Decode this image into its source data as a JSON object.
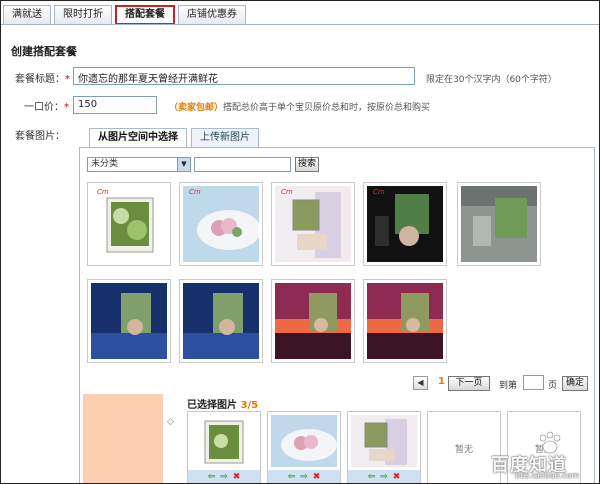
{
  "top_tabs": [
    {
      "label": "满就送",
      "active": false
    },
    {
      "label": "限时打折",
      "active": false
    },
    {
      "label": "搭配套餐",
      "active": true
    },
    {
      "label": "店铺优惠券",
      "active": false
    }
  ],
  "section_title": "创建搭配套餐",
  "form": {
    "title_label": "套餐标题：",
    "title_value": "你遗忘的那年夏天曾经开满鲜花",
    "title_hint": "限定在30个汉字内（60个字符）",
    "price_label": "一口价：",
    "price_value": "150",
    "price_hint_tag": "（卖家包邮）",
    "price_hint": "搭配总价高于单个宝贝原价总和时，按原价总和购买",
    "image_label": "套餐图片：",
    "required_mark": "*"
  },
  "image_tabs": [
    {
      "label": "从图片空间中选择",
      "active": true
    },
    {
      "label": "上传新图片",
      "active": false
    }
  ],
  "category_select": {
    "value": "未分类"
  },
  "search_button": "搜索",
  "thumb_logo_text": "Cm",
  "thumbnails": [
    {
      "theme": "green-frame"
    },
    {
      "theme": "plate"
    },
    {
      "theme": "curtain"
    },
    {
      "theme": "dark-portrait"
    },
    {
      "theme": "stone-window"
    },
    {
      "theme": "blue-night"
    },
    {
      "theme": "blue-night"
    },
    {
      "theme": "sunset"
    },
    {
      "theme": "sunset"
    }
  ],
  "pagination": {
    "current": "1",
    "next_label": "下一页",
    "goto_label": "到第",
    "page_unit": "页",
    "confirm_label": "确定"
  },
  "selected": {
    "title": "已选择图片",
    "count": "3/5",
    "empty_label": "暂无"
  },
  "watermark": {
    "main": "百度知道",
    "url": "bbs.taobao.com"
  },
  "colors": {
    "accent_orange": "#e47a00",
    "active_tab_border": "#d21f1f",
    "preview_peach": "#fccfb3"
  }
}
